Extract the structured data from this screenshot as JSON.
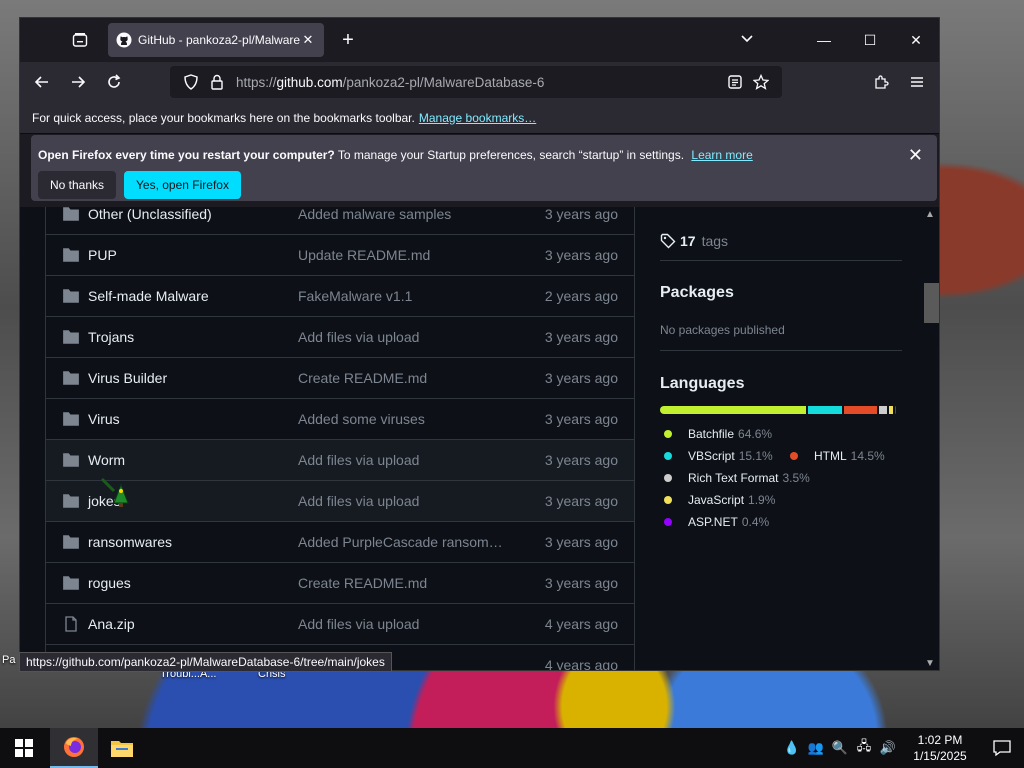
{
  "desktop": {
    "labels": [
      "Troubl...A...",
      "Crisis",
      "Pa"
    ]
  },
  "browser": {
    "tab": {
      "title": "GitHub - pankoza2-pl/Malware[",
      "close": "✕"
    },
    "new_tab": "+",
    "url_prefix": "https://",
    "url_host": "github.com",
    "url_path": "/pankoza2-pl/MalwareDatabase-6",
    "bookmarks_text": "For quick access, place your bookmarks here on the bookmarks toolbar.",
    "bookmarks_link": "Manage bookmarks…",
    "notification": {
      "bold": "Open Firefox every time you restart your computer?",
      "text": "To manage your Startup preferences, search “startup” in settings.",
      "link": "Learn more",
      "no_button": "No thanks",
      "yes_button": "Yes, open Firefox"
    },
    "status_url": "https://github.com/pankoza2-pl/MalwareDatabase-6/tree/main/jokes"
  },
  "files": [
    {
      "name": "Other (Unclassified)",
      "message": "Added malware samples",
      "date": "3 years ago",
      "type": "dir"
    },
    {
      "name": "PUP",
      "message": "Update README.md",
      "date": "3 years ago",
      "type": "dir"
    },
    {
      "name": "Self-made Malware",
      "message": "FakeMalware v1.1",
      "date": "2 years ago",
      "type": "dir"
    },
    {
      "name": "Trojans",
      "message": "Add files via upload",
      "date": "3 years ago",
      "type": "dir"
    },
    {
      "name": "Virus Builder",
      "message": "Create README.md",
      "date": "3 years ago",
      "type": "dir"
    },
    {
      "name": "Virus",
      "message": "Added some viruses",
      "date": "3 years ago",
      "type": "dir"
    },
    {
      "name": "Worm",
      "message": "Add files via upload",
      "date": "3 years ago",
      "type": "dir"
    },
    {
      "name": "jokes",
      "message": "Add files via upload",
      "date": "3 years ago",
      "type": "dir"
    },
    {
      "name": "ransomwares",
      "message": "Added PurpleCascade ransom…",
      "date": "3 years ago",
      "type": "dir"
    },
    {
      "name": "rogues",
      "message": "Create README.md",
      "date": "3 years ago",
      "type": "dir"
    },
    {
      "name": "Ana.zip",
      "message": "Add files via upload",
      "date": "4 years ago",
      "type": "file"
    },
    {
      "name": "",
      "message": "onduct",
      "date": "4 years ago",
      "type": "file"
    }
  ],
  "sidebar": {
    "tags_count": "17",
    "tags_label": "tags",
    "packages_title": "Packages",
    "packages_note": "No packages published",
    "languages_title": "Languages",
    "languages": [
      {
        "name": "Batchfile",
        "pct": "64.6%",
        "value": 64.6,
        "color": "#c1f12e"
      },
      {
        "name": "VBScript",
        "pct": "15.1%",
        "value": 15.1,
        "color": "#15dcdc"
      },
      {
        "name": "HTML",
        "pct": "14.5%",
        "value": 14.5,
        "color": "#e34c26"
      },
      {
        "name": "Rich Text Format",
        "pct": "3.5%",
        "value": 3.5,
        "color": "#cccccc"
      },
      {
        "name": "JavaScript",
        "pct": "1.9%",
        "value": 1.9,
        "color": "#f1e05a"
      },
      {
        "name": "ASP.NET",
        "pct": "0.4%",
        "value": 0.4,
        "color": "#9400ff"
      }
    ]
  },
  "taskbar": {
    "time": "1:02 PM",
    "date": "1/15/2025"
  }
}
